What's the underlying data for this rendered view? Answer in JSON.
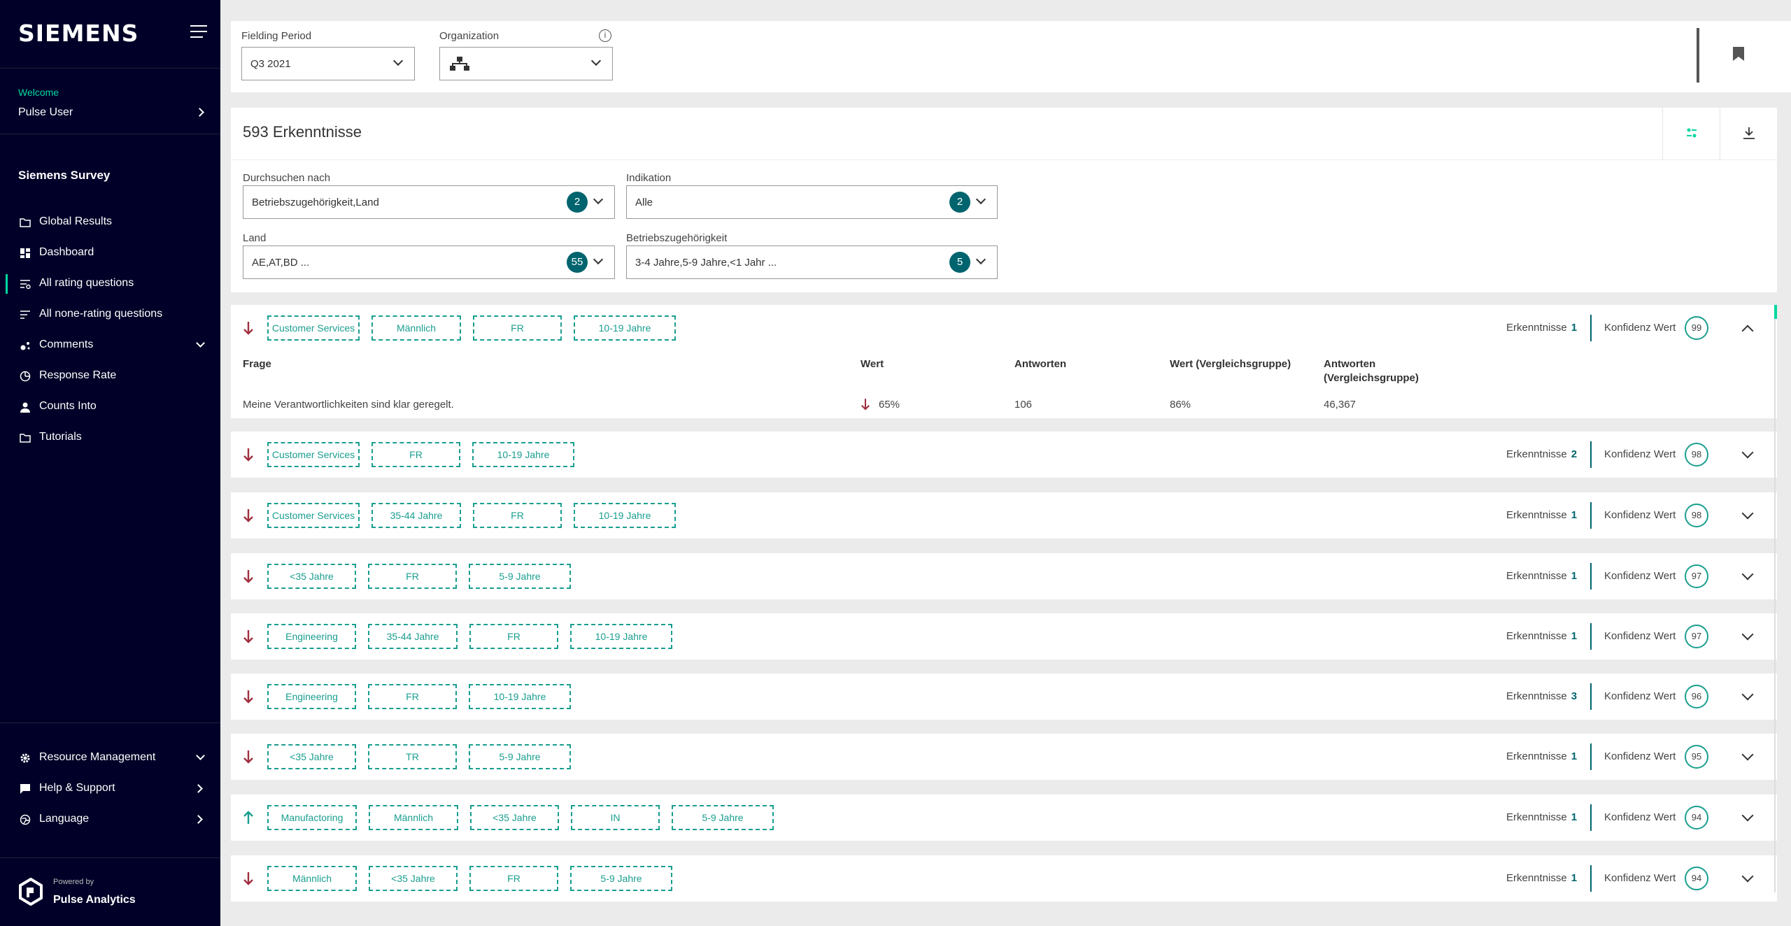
{
  "sidebar": {
    "brand": "SIEMENS",
    "welcome": "Welcome",
    "user_name": "Pulse User",
    "section": "Siemens Survey",
    "items": [
      {
        "label": "Global Results",
        "icon": "folder-icon"
      },
      {
        "label": "Dashboard",
        "icon": "dashboard-icon"
      },
      {
        "label": "All rating questions",
        "icon": "filter-list-icon",
        "active": true
      },
      {
        "label": "All none-rating questions",
        "icon": "lines-icon"
      },
      {
        "label": "Comments",
        "icon": "comments-icon",
        "expand": true
      },
      {
        "label": "Response Rate",
        "icon": "pie-icon"
      },
      {
        "label": "Counts Into",
        "icon": "person-icon"
      },
      {
        "label": "Tutorials",
        "icon": "folder-icon"
      }
    ],
    "bottom_items": [
      {
        "label": "Resource Management",
        "icon": "gear-icon"
      },
      {
        "label": "Help & Support",
        "icon": "chat-icon"
      },
      {
        "label": "Language",
        "icon": "globe-icon"
      }
    ],
    "powered_by": "Powered by",
    "product": "Pulse Analytics"
  },
  "filters": {
    "fielding_label": "Fielding Period",
    "fielding_value": "Q3 2021",
    "org_label": "Organization",
    "org_value": ""
  },
  "panel": {
    "title": "593 Erkenntnisse",
    "search_label": "Durchsuchen nach",
    "search_value": "Betriebszugehörigkeit,Land",
    "search_count": "2",
    "indikation_label": "Indikation",
    "indikation_value": "Alle",
    "indikation_count": "2",
    "land_label": "Land",
    "land_value": "AE,AT,BD ...",
    "land_count": "55",
    "betrieb_label": "Betriebszugehörigkeit",
    "betrieb_value": "3-4 Jahre,5-9 Jahre,<1 Jahr ...",
    "betrieb_count": "5"
  },
  "colors": {
    "accent": "#1a9e8f",
    "dark": "#00646e",
    "down": "#a03040",
    "up": "#1a9e8f",
    "sidebar": "#000028",
    "highlight": "#00d7a0"
  },
  "labels": {
    "erkenntnisse": "Erkenntnisse",
    "konfidenz": "Konfidenz Wert"
  },
  "expanded": {
    "headers": {
      "frage": "Frage",
      "wert": "Wert",
      "antworten": "Antworten",
      "wert_vg": "Wert (Vergleichsgruppe)",
      "antworten_vg_1": "Antworten",
      "antworten_vg_2": "(Vergleichsgruppe)"
    },
    "row": {
      "frage": "Meine Verantwortlichkeiten sind klar geregelt.",
      "wert": "65%",
      "antworten": "106",
      "wert_vg": "86%",
      "antworten_vg": "46,367"
    }
  },
  "rows": [
    {
      "dir": "down",
      "tags": [
        "Customer Services",
        "Männlich",
        "FR",
        "10-19 Jahre"
      ],
      "count": "1",
      "score": "99",
      "expanded": true
    },
    {
      "dir": "down",
      "tags": [
        "Customer Services",
        "FR",
        "10-19 Jahre"
      ],
      "count": "2",
      "score": "98"
    },
    {
      "dir": "down",
      "tags": [
        "Customer Services",
        "35-44 Jahre",
        "FR",
        "10-19 Jahre"
      ],
      "count": "1",
      "score": "98"
    },
    {
      "dir": "down",
      "tags": [
        "<35 Jahre",
        "FR",
        "5-9 Jahre"
      ],
      "count": "1",
      "score": "97"
    },
    {
      "dir": "down",
      "tags": [
        "Engineering",
        "35-44 Jahre",
        "FR",
        "10-19 Jahre"
      ],
      "count": "1",
      "score": "97"
    },
    {
      "dir": "down",
      "tags": [
        "Engineering",
        "FR",
        "10-19 Jahre"
      ],
      "count": "3",
      "score": "96"
    },
    {
      "dir": "down",
      "tags": [
        "<35 Jahre",
        "TR",
        "5-9 Jahre"
      ],
      "count": "1",
      "score": "95"
    },
    {
      "dir": "up",
      "tags": [
        "Manufactoring",
        "Männlich",
        "<35 Jahre",
        "IN",
        "5-9 Jahre"
      ],
      "count": "1",
      "score": "94"
    },
    {
      "dir": "down",
      "tags": [
        "Männlich",
        "<35 Jahre",
        "FR",
        "5-9 Jahre"
      ],
      "count": "1",
      "score": "94"
    }
  ]
}
